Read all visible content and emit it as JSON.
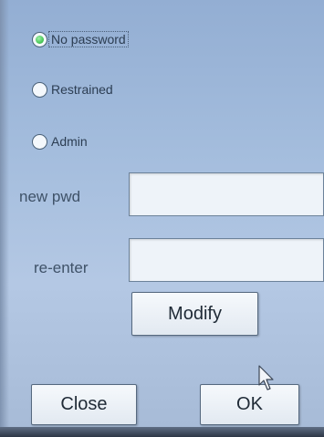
{
  "password_mode": {
    "options": [
      {
        "label": "No password",
        "selected": true
      },
      {
        "label": "Restrained",
        "selected": false
      },
      {
        "label": "Admin",
        "selected": false
      }
    ]
  },
  "fields": {
    "new_pwd": {
      "label": "new pwd",
      "value": ""
    },
    "re_enter": {
      "label": "re-enter",
      "value": ""
    }
  },
  "buttons": {
    "modify": "Modify",
    "close": "Close",
    "ok": "OK"
  },
  "icons": {
    "pointer": "mouse-pointer-icon"
  },
  "colors": {
    "background": "#a4bddd",
    "radio_selected": "#4cc85a",
    "button_face": "#eef3f8"
  }
}
